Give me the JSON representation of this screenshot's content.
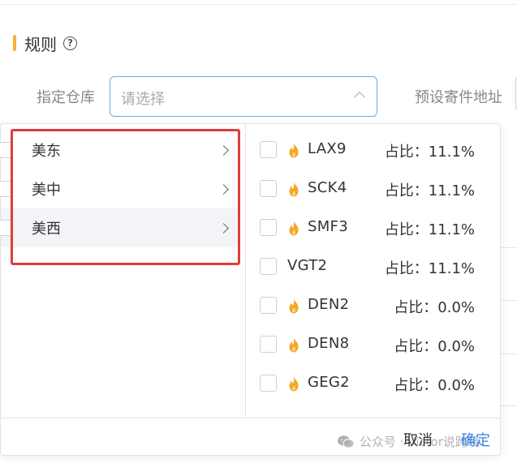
{
  "section": {
    "title": "规则",
    "help_icon": "?"
  },
  "form": {
    "warehouse_label": "指定仓库",
    "warehouse_placeholder": "请选择",
    "address_label": "预设寄件地址"
  },
  "regions": [
    {
      "label": "美东",
      "active": false
    },
    {
      "label": "美中",
      "active": false
    },
    {
      "label": "美西",
      "active": true
    }
  ],
  "warehouses": [
    {
      "code": "LAX9",
      "ratio": "占比：11.1%",
      "hot": true
    },
    {
      "code": "SCK4",
      "ratio": "占比：11.1%",
      "hot": true
    },
    {
      "code": "SMF3",
      "ratio": "占比：11.1%",
      "hot": true
    },
    {
      "code": "VGT2",
      "ratio": "占比：11.1%",
      "hot": false
    },
    {
      "code": "DEN2",
      "ratio": "占比：0.0%",
      "hot": true
    },
    {
      "code": "DEN8",
      "ratio": "占比：0.0%",
      "hot": true
    },
    {
      "code": "GEG2",
      "ratio": "占比：0.0%",
      "hot": true
    }
  ],
  "footer": {
    "cancel_label": "取消",
    "confirm_label": "确定"
  },
  "watermark": {
    "text": "公众号 · Victor说跨境"
  },
  "colors": {
    "accent_bar": "#f3b431",
    "primary": "#2d82e8",
    "highlight": "#e03c3c",
    "flame": "#f5a623"
  }
}
